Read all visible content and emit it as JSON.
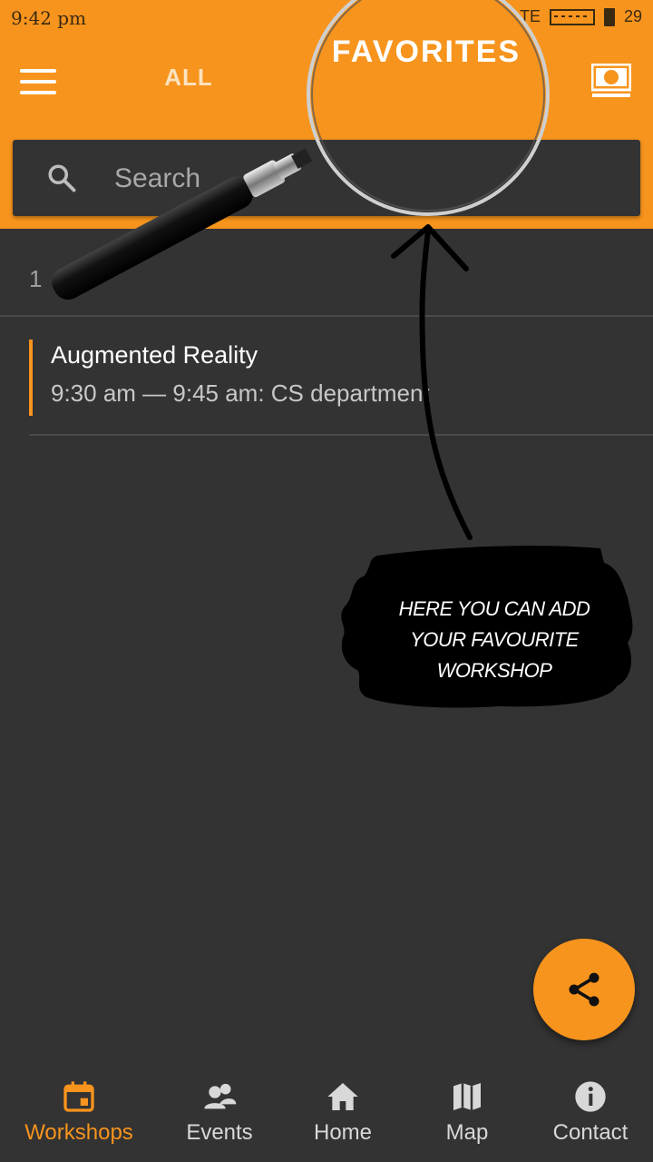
{
  "status_bar": {
    "time": "9:42 pm",
    "network": "TE",
    "battery": "29"
  },
  "header": {
    "tab_all": "ALL",
    "tab_favorites": "FAVORITES"
  },
  "search": {
    "placeholder": "Search"
  },
  "date_label": "1",
  "workshops": [
    {
      "title": "Augmented Reality",
      "time_location": "9:30 am — 9:45 am: CS department"
    }
  ],
  "annotation": {
    "line1": "HERE YOU CAN ADD",
    "line2": "YOUR FAVOURITE WORKSHOP"
  },
  "bottom_nav": [
    {
      "label": "Workshops",
      "icon": "calendar-icon",
      "active": true
    },
    {
      "label": "Events",
      "icon": "people-icon",
      "active": false
    },
    {
      "label": "Home",
      "icon": "home-icon",
      "active": false
    },
    {
      "label": "Map",
      "icon": "map-icon",
      "active": false
    },
    {
      "label": "Contact",
      "icon": "info-icon",
      "active": false
    }
  ],
  "colors": {
    "accent": "#F7941D",
    "background": "#333333"
  }
}
